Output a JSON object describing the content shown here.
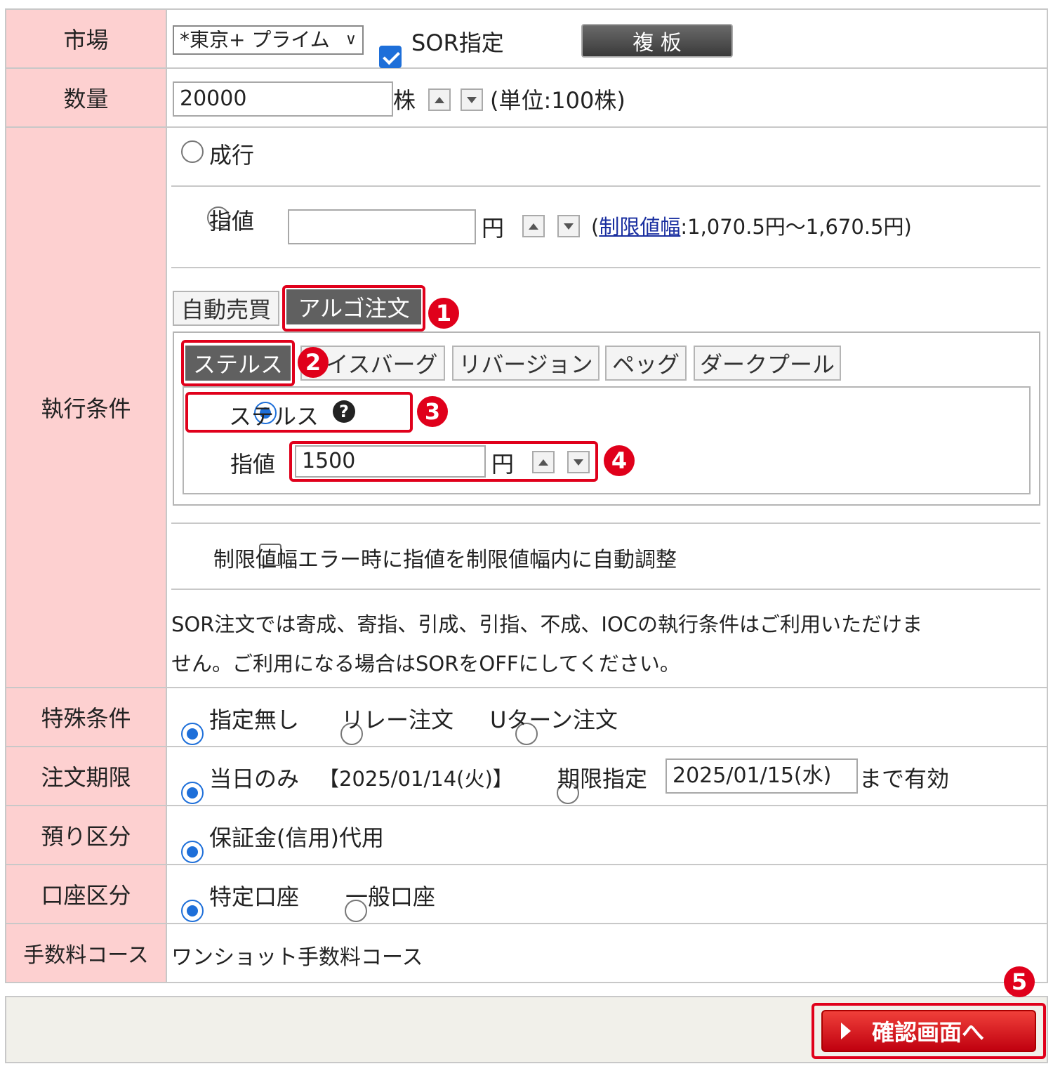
{
  "market": {
    "label": "市場",
    "select_value": "*東京+ プライム",
    "sor_label": "SOR指定",
    "sor_checked": true,
    "board_button": "複 板"
  },
  "quantity": {
    "label": "数量",
    "value": "20000",
    "unit": "株",
    "note": "(単位:100株)"
  },
  "execution": {
    "label": "執行条件",
    "market_order": "成行",
    "limit_order": "指値",
    "limit_value": "",
    "limit_unit": "円",
    "range_prefix": "(",
    "range_link": "制限値幅",
    "range_text": ":1,070.5円〜1,670.5円)",
    "top_tabs": [
      "自動売買",
      "アルゴ注文"
    ],
    "algo_tabs": [
      "ステルス",
      "アイスバーグ",
      "リバージョン",
      "ペッグ",
      "ダークプール"
    ],
    "stealth_option": "ステルス",
    "stealth_limit_label": "指値",
    "stealth_limit_value": "1500",
    "stealth_limit_unit": "円",
    "auto_adjust": "制限値幅エラー時に指値を制限値幅内に自動調整",
    "sor_note_1": "SOR注文では寄成、寄指、引成、引指、不成、IOCの執行条件はご利用いただけま",
    "sor_note_2": "せん。ご利用になる場合はSORをOFFにしてください。"
  },
  "special": {
    "label": "特殊条件",
    "options": [
      "指定無し",
      "リレー注文",
      "Uターン注文"
    ]
  },
  "expiry": {
    "label": "注文期限",
    "today": "当日のみ",
    "today_date": "【2025/01/14(火)】",
    "specify": "期限指定",
    "date_value": "2025/01/15(水)",
    "valid_until": "まで有効"
  },
  "deposit": {
    "label": "預り区分",
    "option": "保証金(信用)代用"
  },
  "account": {
    "label": "口座区分",
    "options": [
      "特定口座",
      "一般口座"
    ]
  },
  "fee": {
    "label": "手数料コース",
    "value": "ワンショット手数料コース"
  },
  "confirm_button": "確認画面へ",
  "badges": [
    "1",
    "2",
    "3",
    "4",
    "5"
  ],
  "colors": {
    "label_bg": "#fdd0d0",
    "highlight": "#e0001b",
    "radio_on": "#1e6fd9",
    "tab_active": "#606060",
    "link": "#1a2fa0"
  }
}
